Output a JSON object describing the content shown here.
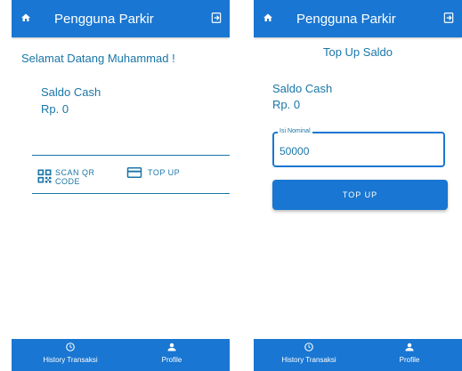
{
  "app_bar": {
    "title": "Pengguna Parkir",
    "home_icon": "home-icon",
    "exit_icon": "exit-icon"
  },
  "bottom_nav": {
    "items": [
      {
        "label": "History Transaksi",
        "icon": "history-icon"
      },
      {
        "label": "Profile",
        "icon": "person-icon"
      }
    ]
  },
  "home_screen": {
    "welcome": "Selamat Datang Muhammad !",
    "saldo_label": "Saldo Cash",
    "saldo_value": "Rp. 0",
    "actions": {
      "scan_qr": {
        "line1": "SCAN QR",
        "line2": "CODE",
        "icon": "qr-code-icon"
      },
      "top_up": {
        "label": "TOP UP",
        "icon": "credit-card-icon"
      }
    }
  },
  "topup_screen": {
    "heading": "Top Up Saldo",
    "saldo_label": "Saldo Cash",
    "saldo_value": "Rp. 0",
    "nominal_field": {
      "label": "Isi Nominal",
      "value": "50000"
    },
    "button_label": "TOP UP"
  },
  "colors": {
    "primary": "#1976d2",
    "text_accent": "#1976a8",
    "background": "#ffffff"
  }
}
